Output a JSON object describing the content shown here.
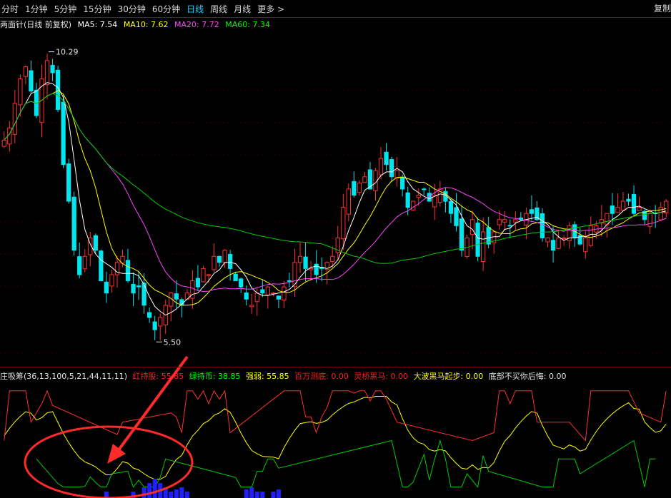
{
  "toolbar": {
    "items": [
      {
        "label": "分时",
        "active": false
      },
      {
        "label": "1分钟",
        "active": false
      },
      {
        "label": "5分钟",
        "active": false
      },
      {
        "label": "15分钟",
        "active": false
      },
      {
        "label": "30分钟",
        "active": false
      },
      {
        "label": "60分钟",
        "active": false
      },
      {
        "label": "日线",
        "active": true
      },
      {
        "label": "周线",
        "active": false
      },
      {
        "label": "月线",
        "active": false
      },
      {
        "label": "更多 >",
        "active": false
      }
    ],
    "corner_label": "复制"
  },
  "main_panel": {
    "title": "两面针(日线 前复权)",
    "ma": [
      {
        "label": "MA5: 7.54",
        "color": "#ffffff"
      },
      {
        "label": "MA10: 7.62",
        "color": "#ffff00"
      },
      {
        "label": "MA20: 7.72",
        "color": "#ff44ff"
      },
      {
        "label": "MA60: 7.34",
        "color": "#00ff00"
      }
    ],
    "high_label": "10.29",
    "low_label": "5.50"
  },
  "indicator_panel": {
    "title": "庄吸筹(36,13,100,5,21,44,11,11)",
    "fields": [
      {
        "label": "红持股: 55.85",
        "color": "#ff2020"
      },
      {
        "label": "绿持币: 38.85",
        "color": "#00ff00"
      },
      {
        "label": "强弱: 55.85",
        "color": "#ffff00"
      },
      {
        "label": "百万测底: 0.00",
        "color": "#ff2020"
      },
      {
        "label": "灵桥黑马: 0.00",
        "color": "#ff2020"
      },
      {
        "label": "大波黑马起步: 0.00",
        "color": "#ffff00"
      },
      {
        "label": "底部不买你后悔: 0.00",
        "color": "#e0e0e0"
      }
    ]
  },
  "colors": {
    "up": "#ff3030",
    "down": "#00e5ee",
    "ma5": "#ffffff",
    "ma10": "#ffff00",
    "ma20": "#ff44ff",
    "ma60": "#00cc00",
    "annotation": "#ff2a2a",
    "bars": "#2020ff"
  },
  "chart_data": {
    "type": "candlestick",
    "price_range": [
      5.2,
      10.6
    ],
    "closes": [
      8.8,
      9.0,
      9.4,
      9.8,
      10.0,
      9.6,
      9.2,
      9.8,
      10.1,
      9.9,
      9.3,
      8.4,
      7.8,
      7.0,
      6.6,
      6.9,
      7.2,
      7.0,
      6.5,
      6.3,
      6.6,
      6.8,
      6.9,
      6.5,
      6.3,
      6.4,
      6.1,
      5.9,
      5.7,
      5.9,
      6.1,
      6.3,
      6.2,
      6.1,
      6.3,
      6.5,
      6.4,
      6.7,
      6.6,
      6.9,
      6.8,
      7.0,
      6.7,
      6.5,
      6.4,
      6.2,
      6.1,
      6.3,
      6.3,
      6.4,
      6.3,
      6.2,
      6.4,
      6.5,
      6.8,
      6.9,
      6.7,
      6.7,
      6.6,
      6.7,
      6.8,
      6.9,
      7.2,
      7.7,
      8.0,
      7.9,
      8.1,
      8.2,
      8.0,
      8.3,
      8.5,
      8.4,
      8.2,
      8.3,
      8.0,
      7.7,
      7.8,
      7.9,
      8.0,
      7.8,
      7.9,
      8.0,
      7.8,
      7.6,
      7.4,
      7.0,
      7.2,
      7.5,
      6.9,
      7.3,
      7.1,
      7.3,
      7.5,
      7.5,
      7.4,
      7.5,
      7.5,
      7.6,
      7.6,
      7.5,
      7.2,
      7.2,
      7.0,
      7.2,
      7.2,
      7.4,
      7.2,
      7.1,
      7.2,
      7.4,
      7.4,
      7.5,
      7.6,
      7.6,
      7.7,
      7.8,
      7.8,
      7.6,
      7.7,
      7.5,
      7.6,
      7.6,
      7.7,
      7.8
    ],
    "high_point": 10.29,
    "low_point": 5.5
  }
}
